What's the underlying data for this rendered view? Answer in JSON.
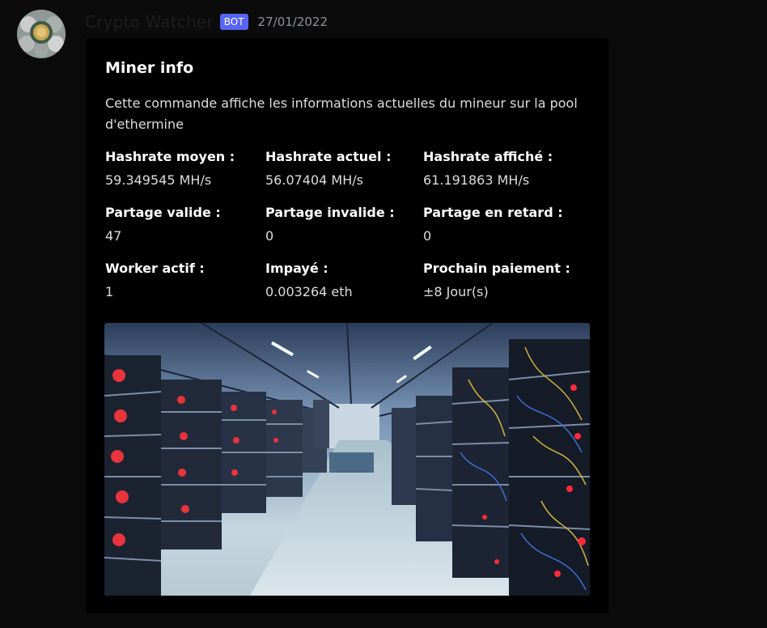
{
  "message": {
    "username": "Crypto Watcher",
    "bot_tag": "BOT",
    "timestamp": "27/01/2022"
  },
  "embed": {
    "title": "Miner info",
    "description": "Cette commande affiche les informations actuelles du mineur sur la pool d'ethermine",
    "fields": [
      {
        "name": "Hashrate moyen :",
        "value": "59.349545 MH/s"
      },
      {
        "name": "Hashrate actuel :",
        "value": "56.07404 MH/s"
      },
      {
        "name": "Hashrate affiché :",
        "value": "61.191863 MH/s"
      },
      {
        "name": "Partage valide :",
        "value": "47"
      },
      {
        "name": "Partage invalide :",
        "value": "0"
      },
      {
        "name": "Partage en retard :",
        "value": "0"
      },
      {
        "name": "Worker actif :",
        "value": "1"
      },
      {
        "name": "Impayé :",
        "value": "0.003264 eth"
      },
      {
        "name": "Prochain paiement :",
        "value": "±8 Jour(s)"
      }
    ],
    "image_description_icon": "mining-farm-photo"
  },
  "colors": {
    "bot_tag": "#5865f2",
    "embed_background": "#000000",
    "page_background": "#0b0b0c"
  }
}
